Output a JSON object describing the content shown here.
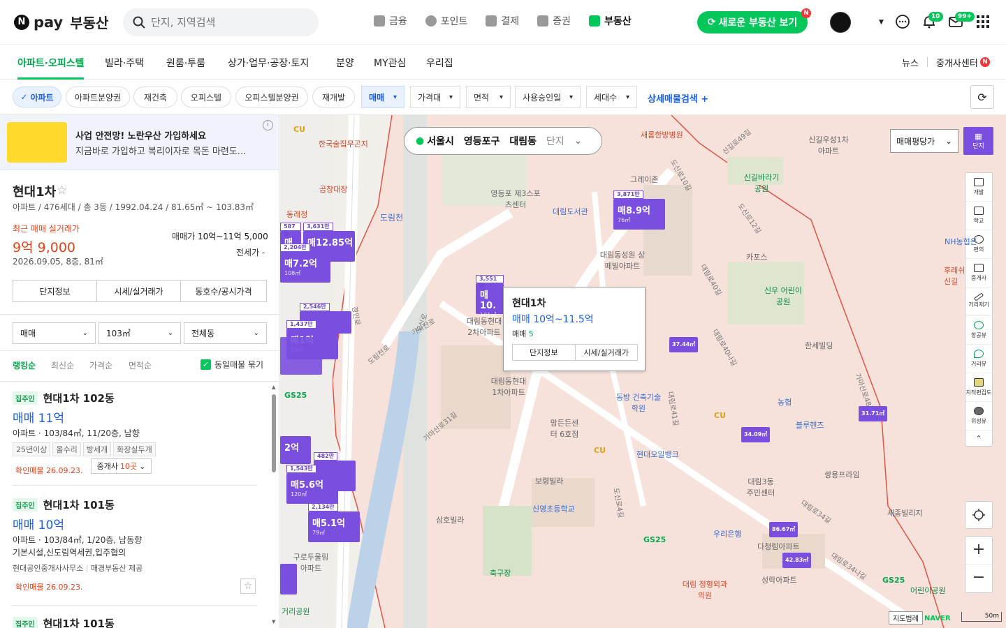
{
  "header": {
    "logo_text": "pay",
    "logo_suffix": "부동산",
    "search_placeholder": "단지, 지역검색",
    "nav": [
      {
        "label": "금융",
        "icon": "wallet-icon"
      },
      {
        "label": "포인트",
        "icon": "point-icon"
      },
      {
        "label": "결제",
        "icon": "receipt-icon"
      },
      {
        "label": "증권",
        "icon": "chart-icon"
      },
      {
        "label": "부동산",
        "icon": "building-icon",
        "active": true
      }
    ],
    "new_button": "새로운 부동산 보기",
    "new_badge": "N",
    "chat_badge": "",
    "bell_badge": "10",
    "mail_badge": "99+"
  },
  "tabs": {
    "items": [
      "아파트·오피스텔",
      "빌라·주택",
      "원룸·투룸",
      "상가·업무·공장·토지",
      "분양",
      "MY관심",
      "우리집"
    ],
    "news": "뉴스",
    "agent_center": "중개사센터",
    "agent_badge": "N"
  },
  "filters": {
    "chips": [
      "아파트",
      "아파트분양권",
      "재건축",
      "오피스텔",
      "오피스텔분양권",
      "재개발"
    ],
    "dropdowns": [
      "매매",
      "가격대",
      "면적",
      "사용승인일",
      "세대수"
    ],
    "detail_search": "상세매물검색"
  },
  "ad": {
    "title": "사업 안전망! 노란우산 가입하세요",
    "desc": "지금바로 가입하고 복리이자로 목돈 마련도..."
  },
  "complex": {
    "name": "현대1차",
    "info": "아파트 / 476세대 / 총 3동 / 1992.04.24 / 81.65㎡ ~ 103.83㎡",
    "recent_label": "최근 매매 실거래가",
    "recent_price": "9억 9,000",
    "recent_date": "2026.09.05, 8층, 81㎡",
    "sale_label": "매매가",
    "sale_range": "10억~11억 5,000",
    "jeonse_label": "전세가",
    "jeonse_value": "-",
    "buttons": [
      "단지정보",
      "시세/실거래가",
      "동호수/공시가격"
    ]
  },
  "list_filters": {
    "type": "매매",
    "area": "103㎡",
    "dong": "전체동",
    "sorts": [
      "랭킹순",
      "최신순",
      "가격순",
      "면적순"
    ],
    "group_same": "동일매물 묶기"
  },
  "listings": [
    {
      "owner_tag": "집주인",
      "title": "현대1차 102동",
      "price": "매매 11억",
      "info": "아파트 · 103/84㎡, 11/20층, 남향",
      "features": [
        "25년이상",
        "올수리",
        "방세개",
        "화장실두개"
      ],
      "confirm": "확인매물 26.09.23.",
      "agents_prefix": "중개사",
      "agents_count": "10곳"
    },
    {
      "owner_tag": "집주인",
      "title": "현대1차 101동",
      "price": "매매 10억",
      "info": "아파트 · 103/84㎡, 1/20층, 남동향",
      "desc": "기본시설,신도림역세권,입주협의",
      "agency": "현대공인중개사사무소",
      "provider": "매경부동산 제공",
      "confirm": "확인매물 26.09.23."
    },
    {
      "owner_tag": "집주인",
      "title": "현대1차 101동"
    }
  ],
  "map": {
    "location": [
      "서울시",
      "영등포구",
      "대림동",
      "단지"
    ],
    "price_toggle": "매매평당가",
    "complex_toggle": "단지",
    "tools": [
      "개발",
      "학교",
      "편의",
      "중개사",
      "거리재기",
      "항공뷰",
      "거리뷰",
      "지적편집도",
      "위성뷰"
    ],
    "popup": {
      "title": "현대1차",
      "price": "매매 10억~11.5억",
      "count_label": "매매",
      "count": "5",
      "btn1": "단지정보",
      "btn2": "시세/실거래가"
    },
    "legend": "지도범례",
    "scale": "50m",
    "brand": "NAVER",
    "markers": [
      {
        "count": "3,871만",
        "price": "매8.9억",
        "area": "76㎡"
      },
      {
        "count": "3,551만",
        "price": "매10.",
        "area": "101㎡"
      },
      {
        "count": "3,631만",
        "price": "매12.85억",
        "area": ""
      },
      {
        "count": "2,204만",
        "price": "매7.2억",
        "area": "108㎡"
      },
      {
        "count": "2,546만",
        "price": "",
        "area": ""
      },
      {
        "count": "1,437만",
        "price": "매1억",
        "area": "23㎡"
      },
      {
        "count": "1,543만",
        "price": "매5.6억",
        "area": "120㎡"
      },
      {
        "count": "2,134만",
        "price": "매5.1억",
        "area": "79㎡"
      },
      {
        "count": "587만",
        "price": "매1.28",
        "area": ""
      },
      {
        "count": "482만",
        "price": "",
        "area": ""
      }
    ],
    "small_markers": [
      "37.44㎡",
      "34.09㎡",
      "31.71㎡",
      "86.67㎡",
      "42.83㎡"
    ],
    "pois": [
      "한국술집무곤지",
      "곱창대장",
      "동래정",
      "도림천",
      "영등포 제3스포츠센터",
      "대림도서관",
      "그레이존",
      "새롬한방병원",
      "신길우성1차 아파트",
      "신길바라기 공원",
      "대림동성원 상떼빌아파트",
      "카포스",
      "신우 어린이공원",
      "NH농협은",
      "후레쉬 신길",
      "대림동현대 2차아파트",
      "대림동현대 1차아파트",
      "한세빌딩",
      "동방 건축기술학원",
      "맘든든센터 6호점",
      "현대오일뱅크",
      "농협",
      "블루헨즈",
      "보령빌라",
      "대림3동 주민센터",
      "쌍용프라임",
      "신영초등학교",
      "삼호빌라",
      "우리은행",
      "세종빌리지",
      "다청림아파트",
      "성락아파트",
      "축구장",
      "대림 정형외과의원",
      "어린이공원",
      "거리공원",
      "구로두울림 아파트"
    ],
    "roads": [
      "도신로",
      "도신로10길",
      "도신로12길",
      "도신로4길",
      "대림로40길",
      "대림로40나길",
      "대림로41길",
      "대림로34길",
      "대림로34나길",
      "가마산로31길",
      "가마산로48길",
      "가마산로",
      "신길로49길",
      "도림천로",
      "경인로"
    ],
    "cvs": [
      "CU",
      "CU",
      "CU",
      "GS25",
      "GS25",
      "GS25"
    ]
  }
}
